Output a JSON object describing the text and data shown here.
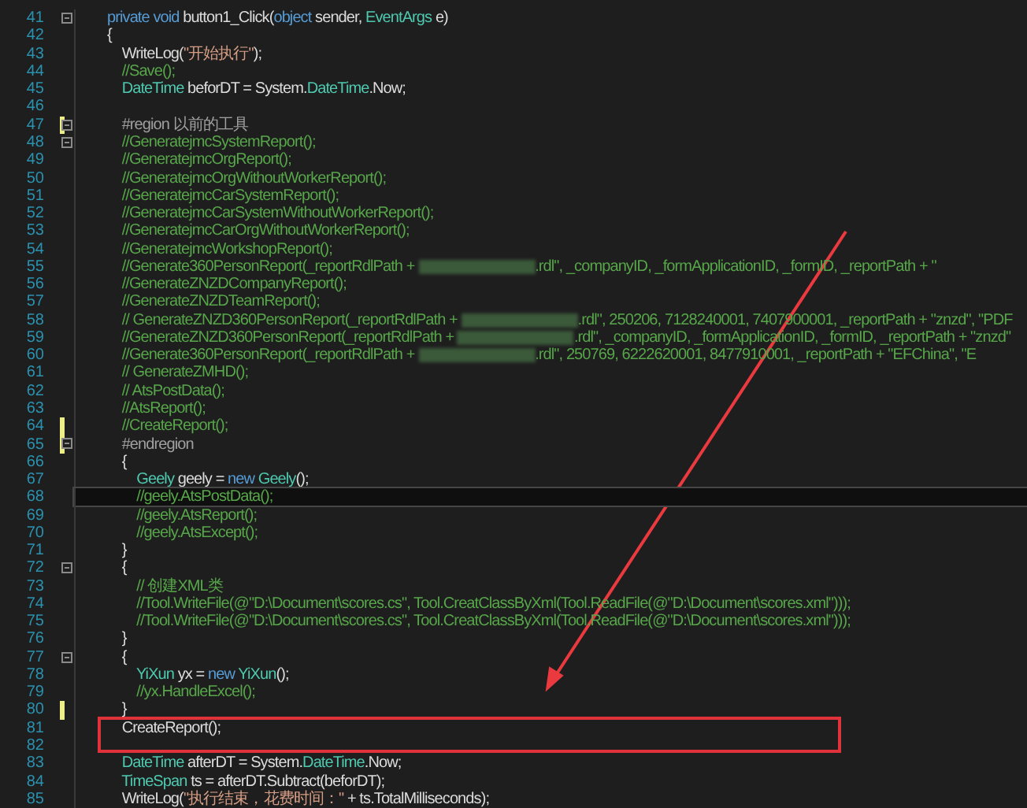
{
  "editor": {
    "lines": [
      {
        "number": "41",
        "changed": false,
        "fold": true,
        "current": false,
        "tokens": [
          {
            "kind": "keyword",
            "text": "private"
          },
          {
            "kind": "keyword",
            "text": " void"
          },
          {
            "kind": "plain",
            "text": " button1_Click("
          },
          {
            "kind": "keyword",
            "text": "object"
          },
          {
            "kind": "plain",
            "text": " sender, "
          },
          {
            "kind": "type",
            "text": "EventArgs"
          },
          {
            "kind": "plain",
            "text": " e)"
          }
        ]
      },
      {
        "number": "42",
        "changed": false,
        "fold": false,
        "current": false,
        "tokens": [
          {
            "kind": "plain",
            "text": "{"
          }
        ]
      },
      {
        "number": "43",
        "changed": false,
        "fold": false,
        "current": false,
        "tokens": [
          {
            "kind": "plain",
            "text": "    WriteLog("
          },
          {
            "kind": "string",
            "text": "\"开始执行\""
          },
          {
            "kind": "plain",
            "text": ");"
          }
        ]
      },
      {
        "number": "44",
        "changed": false,
        "fold": false,
        "current": false,
        "tokens": [
          {
            "kind": "comment",
            "text": "    //Save();"
          }
        ]
      },
      {
        "number": "45",
        "changed": false,
        "fold": false,
        "current": false,
        "tokens": [
          {
            "kind": "type",
            "text": "    DateTime"
          },
          {
            "kind": "plain",
            "text": " beforDT = System."
          },
          {
            "kind": "type",
            "text": "DateTime"
          },
          {
            "kind": "plain",
            "text": ".Now;"
          }
        ]
      },
      {
        "number": "46",
        "changed": false,
        "fold": false,
        "current": false
      },
      {
        "number": "47",
        "changed": true,
        "fold": true,
        "current": false,
        "tokens": [
          {
            "kind": "preproc",
            "text": "    #region 以前的工具"
          }
        ]
      },
      {
        "number": "48",
        "changed": false,
        "fold": true,
        "current": false,
        "tokens": [
          {
            "kind": "comment",
            "text": "    //GeneratejmcSystemReport();"
          }
        ]
      },
      {
        "number": "49",
        "changed": false,
        "fold": false,
        "current": false,
        "tokens": [
          {
            "kind": "comment",
            "text": "    //GeneratejmcOrgReport();"
          }
        ]
      },
      {
        "number": "50",
        "changed": false,
        "fold": false,
        "current": false,
        "tokens": [
          {
            "kind": "comment",
            "text": "    //GeneratejmcOrgWithoutWorkerReport();"
          }
        ]
      },
      {
        "number": "51",
        "changed": false,
        "fold": false,
        "current": false,
        "tokens": [
          {
            "kind": "comment",
            "text": "    //GeneratejmcCarSystemReport();"
          }
        ]
      },
      {
        "number": "52",
        "changed": false,
        "fold": false,
        "current": false,
        "tokens": [
          {
            "kind": "comment",
            "text": "    //GeneratejmcCarSystemWithoutWorkerReport();"
          }
        ]
      },
      {
        "number": "53",
        "changed": false,
        "fold": false,
        "current": false,
        "tokens": [
          {
            "kind": "comment",
            "text": "    //GeneratejmcCarOrgWithoutWorkerReport();"
          }
        ]
      },
      {
        "number": "54",
        "changed": false,
        "fold": false,
        "current": false,
        "tokens": [
          {
            "kind": "comment",
            "text": "    //GeneratejmcWorkshopReport();"
          }
        ]
      },
      {
        "number": "55",
        "changed": false,
        "fold": false,
        "current": false,
        "tokens": [
          {
            "kind": "comment",
            "text": "    //Generate360PersonReport(_reportRdlPath + "
          },
          {
            "kind": "redacted"
          },
          {
            "kind": "comment",
            "text": ".rdl\", _companyID, _formApplicationID, _formID, _reportPath + \""
          }
        ]
      },
      {
        "number": "56",
        "changed": false,
        "fold": false,
        "current": false,
        "tokens": [
          {
            "kind": "comment",
            "text": "    //GenerateZNZDCompanyReport();"
          }
        ]
      },
      {
        "number": "57",
        "changed": false,
        "fold": false,
        "current": false,
        "tokens": [
          {
            "kind": "comment",
            "text": "    //GenerateZNZDTeamReport();"
          }
        ]
      },
      {
        "number": "58",
        "changed": false,
        "fold": false,
        "current": false,
        "tokens": [
          {
            "kind": "comment",
            "text": "    // GenerateZNZD360PersonReport(_reportRdlPath + "
          },
          {
            "kind": "redacted"
          },
          {
            "kind": "comment",
            "text": ".rdl\", 250206, 7128240001, 7407900001, _reportPath + \"znzd\", \"PDF"
          }
        ]
      },
      {
        "number": "59",
        "changed": false,
        "fold": false,
        "current": false,
        "tokens": [
          {
            "kind": "comment",
            "text": "    //GenerateZNZD360PersonReport(_reportRdlPath + "
          },
          {
            "kind": "redacted"
          },
          {
            "kind": "comment",
            "text": ".rdl\", _companyID, _formApplicationID, _formID, _reportPath + \"znzd\""
          }
        ]
      },
      {
        "number": "60",
        "changed": false,
        "fold": false,
        "current": false,
        "tokens": [
          {
            "kind": "comment",
            "text": "    //Generate360PersonReport(_reportRdlPath + "
          },
          {
            "kind": "redacted"
          },
          {
            "kind": "comment",
            "text": ".rdl\", 250769, 6222620001, 8477910001, _reportPath + \"EFChina\", \"E"
          }
        ]
      },
      {
        "number": "61",
        "changed": false,
        "fold": false,
        "current": false,
        "tokens": [
          {
            "kind": "comment",
            "text": "    // GenerateZMHD();"
          }
        ]
      },
      {
        "number": "62",
        "changed": false,
        "fold": false,
        "current": false,
        "tokens": [
          {
            "kind": "comment",
            "text": "    // AtsPostData();"
          }
        ]
      },
      {
        "number": "63",
        "changed": false,
        "fold": false,
        "current": false,
        "tokens": [
          {
            "kind": "comment",
            "text": "    //AtsReport();"
          }
        ]
      },
      {
        "number": "64",
        "changed": true,
        "fold": false,
        "current": false,
        "tokens": [
          {
            "kind": "comment",
            "text": "    //CreateReport();"
          }
        ]
      },
      {
        "number": "65",
        "changed": true,
        "fold": true,
        "current": false,
        "tokens": [
          {
            "kind": "preproc",
            "text": "    #endregion"
          }
        ]
      },
      {
        "number": "66",
        "changed": false,
        "fold": false,
        "current": false,
        "tokens": [
          {
            "kind": "plain",
            "text": "    {"
          }
        ]
      },
      {
        "number": "67",
        "changed": false,
        "fold": false,
        "current": false,
        "tokens": [
          {
            "kind": "type",
            "text": "        Geely"
          },
          {
            "kind": "plain",
            "text": " geely = "
          },
          {
            "kind": "keyword",
            "text": "new"
          },
          {
            "kind": "type",
            "text": " Geely"
          },
          {
            "kind": "plain",
            "text": "();"
          }
        ]
      },
      {
        "number": "68",
        "changed": false,
        "fold": false,
        "current": true,
        "tokens": [
          {
            "kind": "comment",
            "text": "        //geely.AtsPostData();"
          }
        ]
      },
      {
        "number": "69",
        "changed": false,
        "fold": false,
        "current": false,
        "tokens": [
          {
            "kind": "comment",
            "text": "        //geely.AtsReport();"
          }
        ]
      },
      {
        "number": "70",
        "changed": false,
        "fold": false,
        "current": false,
        "tokens": [
          {
            "kind": "comment",
            "text": "        //geely.AtsExcept();"
          }
        ]
      },
      {
        "number": "71",
        "changed": false,
        "fold": false,
        "current": false,
        "tokens": [
          {
            "kind": "plain",
            "text": "    }"
          }
        ]
      },
      {
        "number": "72",
        "changed": false,
        "fold": true,
        "current": false,
        "tokens": [
          {
            "kind": "plain",
            "text": "    {"
          }
        ]
      },
      {
        "number": "73",
        "changed": false,
        "fold": false,
        "current": false,
        "tokens": [
          {
            "kind": "comment",
            "text": "        // 创建XML类"
          }
        ]
      },
      {
        "number": "74",
        "changed": false,
        "fold": false,
        "current": false,
        "tokens": [
          {
            "kind": "comment",
            "text": "        //Tool.WriteFile(@\"D:\\Document\\scores.cs\", Tool.CreatClassByXml(Tool.ReadFile(@\"D:\\Document\\scores.xml\")));"
          }
        ]
      },
      {
        "number": "75",
        "changed": false,
        "fold": false,
        "current": false,
        "tokens": [
          {
            "kind": "comment",
            "text": "        //Tool.WriteFile(@\"D:\\Document\\scores.cs\", Tool.CreatClassByXml(Tool.ReadFile(@\"D:\\Document\\scores.xml\")));"
          }
        ]
      },
      {
        "number": "76",
        "changed": false,
        "fold": false,
        "current": false,
        "tokens": [
          {
            "kind": "plain",
            "text": "    }"
          }
        ]
      },
      {
        "number": "77",
        "changed": false,
        "fold": true,
        "current": false,
        "tokens": [
          {
            "kind": "plain",
            "text": "    {"
          }
        ]
      },
      {
        "number": "78",
        "changed": false,
        "fold": false,
        "current": false,
        "tokens": [
          {
            "kind": "type",
            "text": "        YiXun"
          },
          {
            "kind": "plain",
            "text": " yx = "
          },
          {
            "kind": "keyword",
            "text": "new"
          },
          {
            "kind": "type",
            "text": " YiXun"
          },
          {
            "kind": "plain",
            "text": "();"
          }
        ]
      },
      {
        "number": "79",
        "changed": false,
        "fold": false,
        "current": false,
        "tokens": [
          {
            "kind": "comment",
            "text": "        //yx.HandleExcel();"
          }
        ]
      },
      {
        "number": "80",
        "changed": true,
        "fold": false,
        "current": false,
        "tokens": [
          {
            "kind": "plain",
            "text": "    }"
          }
        ]
      },
      {
        "number": "81",
        "changed": false,
        "fold": false,
        "current": false,
        "tokens": [
          {
            "kind": "plain",
            "text": "    CreateReport();"
          }
        ]
      },
      {
        "number": "82",
        "changed": false,
        "fold": false,
        "current": false
      },
      {
        "number": "83",
        "changed": false,
        "fold": false,
        "current": false,
        "tokens": [
          {
            "kind": "type",
            "text": "    DateTime"
          },
          {
            "kind": "plain",
            "text": " afterDT = System."
          },
          {
            "kind": "type",
            "text": "DateTime"
          },
          {
            "kind": "plain",
            "text": ".Now;"
          }
        ]
      },
      {
        "number": "84",
        "changed": false,
        "fold": false,
        "current": false,
        "tokens": [
          {
            "kind": "type",
            "text": "    TimeSpan"
          },
          {
            "kind": "plain",
            "text": " ts = afterDT.Subtract(beforDT);"
          }
        ]
      },
      {
        "number": "85",
        "changed": false,
        "fold": false,
        "current": false,
        "tokens": [
          {
            "kind": "plain",
            "text": "    WriteLog("
          },
          {
            "kind": "string",
            "text": "\"执行结束，花费时间：\""
          },
          {
            "kind": "plain",
            "text": " + ts.TotalMilliseconds);"
          }
        ]
      }
    ]
  }
}
